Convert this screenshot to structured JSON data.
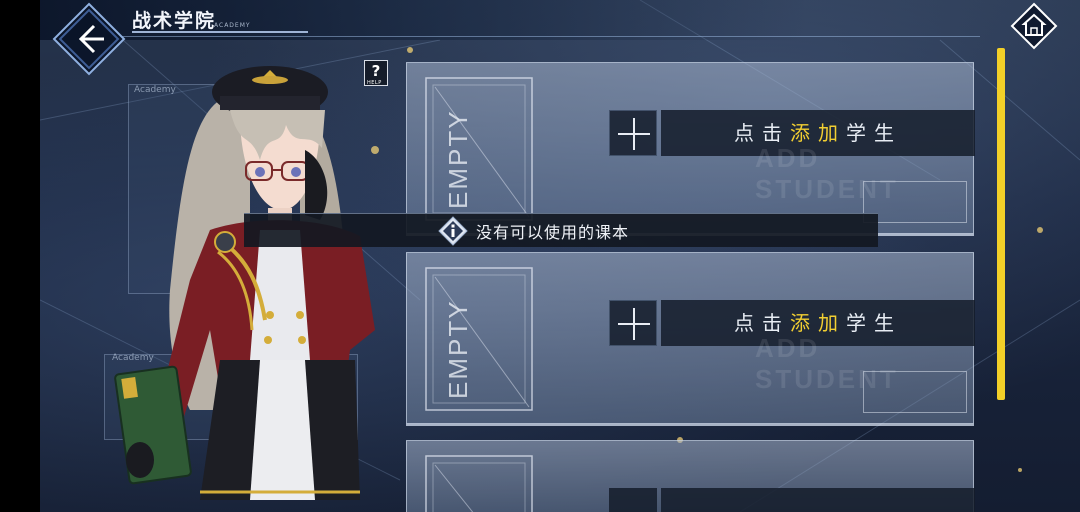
{
  "header": {
    "title": "战术学院",
    "subtitle": "ACADEMY"
  },
  "help": {
    "label": "HELP",
    "glyph": "?"
  },
  "background_panels": {
    "top_title": "Academy",
    "bottom_title": "Academy"
  },
  "slots": [
    {
      "frame_text": "EMPTY",
      "add_parts": [
        "点击",
        "添加",
        "学生"
      ],
      "ghost_text": "ADD STUDENT"
    },
    {
      "frame_text": "EMPTY",
      "add_parts": [
        "点击",
        "添加",
        "学生"
      ],
      "ghost_text": "ADD STUDENT"
    }
  ],
  "toast": {
    "message": "没有可以使用的课本"
  },
  "colors": {
    "accent": "#f3d028",
    "highlight_text": "#f2cf32",
    "panel_dark": "#141c2a"
  },
  "icons": {
    "back": "arrow-left-icon",
    "home": "home-icon",
    "help": "help-icon",
    "info": "info-icon",
    "add": "plus-icon"
  }
}
